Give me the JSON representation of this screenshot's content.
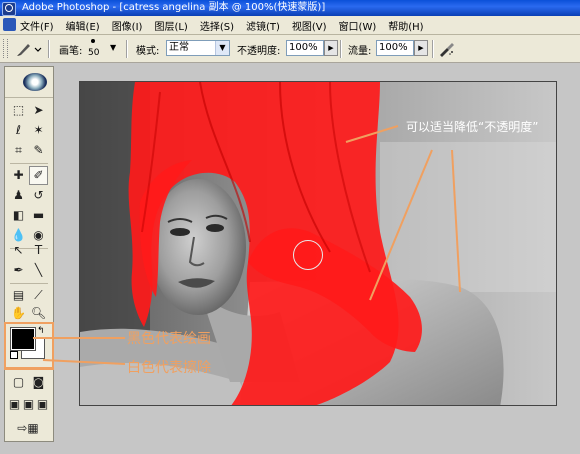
{
  "app": {
    "title": "Adobe Photoshop - [catress angelina 副本 @ 100%(快速蒙版)]"
  },
  "menu": [
    "文件(F)",
    "编辑(E)",
    "图像(I)",
    "图层(L)",
    "选择(S)",
    "滤镜(T)",
    "视图(V)",
    "窗口(W)",
    "帮助(H)"
  ],
  "options": {
    "brush_label": "画笔:",
    "brush_size": "50",
    "mode_label": "模式:",
    "mode_value": "正常",
    "opacity_label": "不透明度:",
    "opacity_value": "100%",
    "flow_label": "流量:",
    "flow_value": "100%"
  },
  "annotations": {
    "opacity_hint": "可以适当降低“不透明度”",
    "black_paint": "黑色代表绘画",
    "white_erase": "白色代表擦除"
  },
  "colors": {
    "mask_red": "#ff1a1a",
    "annotation_orange": "#f0a060",
    "annotation_text_on_photo": "#ffffff",
    "annotation_text_orange": "#f0a060"
  }
}
